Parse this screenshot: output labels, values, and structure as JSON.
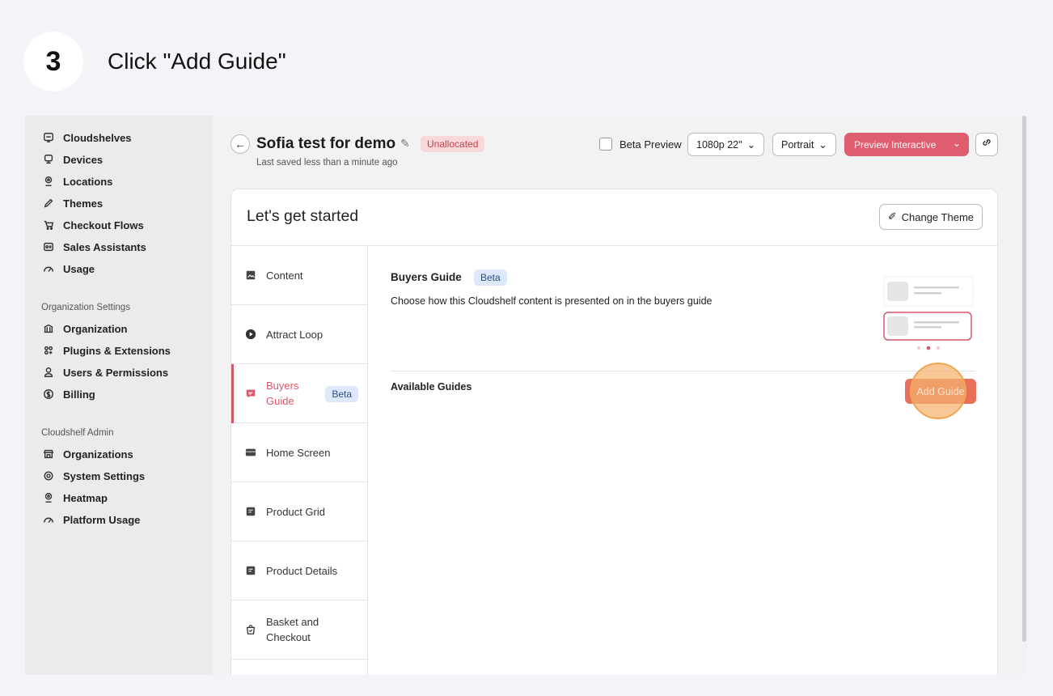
{
  "step": {
    "number": "3",
    "title": "Click \"Add Guide\""
  },
  "sidebar": {
    "items": [
      {
        "label": "Cloudshelves",
        "icon": "cloudshelf-icon"
      },
      {
        "label": "Devices",
        "icon": "device-icon"
      },
      {
        "label": "Locations",
        "icon": "location-pin-icon"
      },
      {
        "label": "Themes",
        "icon": "brush-icon"
      },
      {
        "label": "Checkout Flows",
        "icon": "cart-icon"
      },
      {
        "label": "Sales Assistants",
        "icon": "id-card-icon"
      },
      {
        "label": "Usage",
        "icon": "gauge-icon"
      }
    ],
    "org_section_title": "Organization Settings",
    "org_items": [
      {
        "label": "Organization",
        "icon": "bank-icon"
      },
      {
        "label": "Plugins & Extensions",
        "icon": "plugin-icon"
      },
      {
        "label": "Users & Permissions",
        "icon": "user-icon"
      },
      {
        "label": "Billing",
        "icon": "dollar-icon"
      }
    ],
    "admin_section_title": "Cloudshelf Admin",
    "admin_items": [
      {
        "label": "Organizations",
        "icon": "store-icon"
      },
      {
        "label": "System Settings",
        "icon": "gear-icon"
      },
      {
        "label": "Heatmap",
        "icon": "location-pin-icon"
      },
      {
        "label": "Platform Usage",
        "icon": "gauge-icon"
      }
    ]
  },
  "header": {
    "title": "Sofia test for demo",
    "status": "Unallocated",
    "saved": "Last saved less than a minute ago",
    "beta_preview": "Beta Preview",
    "resolution": "1080p 22\"",
    "orientation": "Portrait",
    "preview_button": "Preview Interactive"
  },
  "card": {
    "title": "Let's get started",
    "change_theme": "Change Theme"
  },
  "tabs": [
    {
      "label": "Content",
      "icon": "image-icon"
    },
    {
      "label": "Attract Loop",
      "icon": "play-icon"
    },
    {
      "label": "Buyers Guide",
      "icon": "chat-icon",
      "badge": "Beta"
    },
    {
      "label": "Home Screen",
      "icon": "screen-icon"
    },
    {
      "label": "Product Grid",
      "icon": "document-icon"
    },
    {
      "label": "Product Details",
      "icon": "document-icon"
    },
    {
      "label": "Basket and Checkout",
      "icon": "bag-icon"
    }
  ],
  "buyers_guide": {
    "title": "Buyers Guide",
    "badge": "Beta",
    "description": "Choose how this Cloudshelf content is presented on in the buyers guide",
    "available_title": "Available Guides",
    "add_button": "Add Guide"
  },
  "colors": {
    "accent": "#de5d6f",
    "add_button": "#e8705a",
    "highlight": "#f4b26e"
  }
}
